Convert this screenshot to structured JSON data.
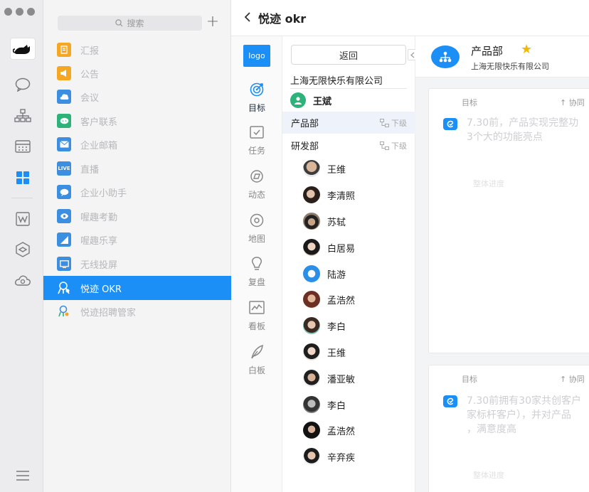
{
  "search": {
    "placeholder": "搜索"
  },
  "app_list": [
    {
      "label": "汇报",
      "icon": "report-icon",
      "color": "#f5a623"
    },
    {
      "label": "公告",
      "icon": "announcement-icon",
      "color": "#f5a623"
    },
    {
      "label": "会议",
      "icon": "meeting-icon",
      "color": "#3b8ee0"
    },
    {
      "label": "客户联系",
      "icon": "customer-contact-icon",
      "color": "#2db37a"
    },
    {
      "label": "企业邮箱",
      "icon": "mail-icon",
      "color": "#3b8ee0"
    },
    {
      "label": "直播",
      "icon": "live-icon",
      "color": "#3b8ee0"
    },
    {
      "label": "企业小助手",
      "icon": "assistant-icon",
      "color": "#3b8ee0"
    },
    {
      "label": "喔趣考勤",
      "icon": "attendance-icon",
      "color": "#3b8ee0"
    },
    {
      "label": "喔趣乐享",
      "icon": "share-icon",
      "color": "#3b8ee0"
    },
    {
      "label": "无线投屏",
      "icon": "screencast-icon",
      "color": "#3b8ee0"
    },
    {
      "label": "悦迹 OKR",
      "icon": "okr-icon",
      "color": "#ffffff"
    },
    {
      "label": "悦迹招聘管家",
      "icon": "recruit-icon",
      "color": "#f5a623"
    }
  ],
  "header": {
    "title": "悦迹 okr"
  },
  "okr_nav": {
    "logo": "logo",
    "items": [
      {
        "label": "目标",
        "icon": "target-icon"
      },
      {
        "label": "任务",
        "icon": "task-icon"
      },
      {
        "label": "动态",
        "icon": "activity-icon"
      },
      {
        "label": "地图",
        "icon": "map-pin-icon"
      },
      {
        "label": "复盘",
        "icon": "bulb-icon"
      },
      {
        "label": "看板",
        "icon": "dashboard-icon"
      },
      {
        "label": "白板",
        "icon": "feather-icon"
      }
    ]
  },
  "tree": {
    "back_label": "返回",
    "company": "上海无限快乐有限公司",
    "leader": "王斌",
    "sub_label": "下级",
    "departments": [
      "产品部",
      "研发部"
    ],
    "members": [
      "王维",
      "李清照",
      "苏轼",
      "白居易",
      "陆游",
      "孟浩然",
      "李白",
      "王维",
      "潘亚敏",
      "李白",
      "孟浩然",
      "辛弃疾"
    ]
  },
  "content": {
    "dept_name": "产品部",
    "company": "上海无限快乐有限公司",
    "col_goal": "目标",
    "col_collab": "↑ 协同",
    "progress_label": "整体进度",
    "cards": [
      {
        "lines": [
          "7.30前，产品实现完整功",
          "3个大的功能亮点"
        ]
      },
      {
        "lines": [
          "7.30前拥有30家共创客户",
          "家标杆客户），并对产品",
          "，满意度高"
        ]
      }
    ]
  }
}
